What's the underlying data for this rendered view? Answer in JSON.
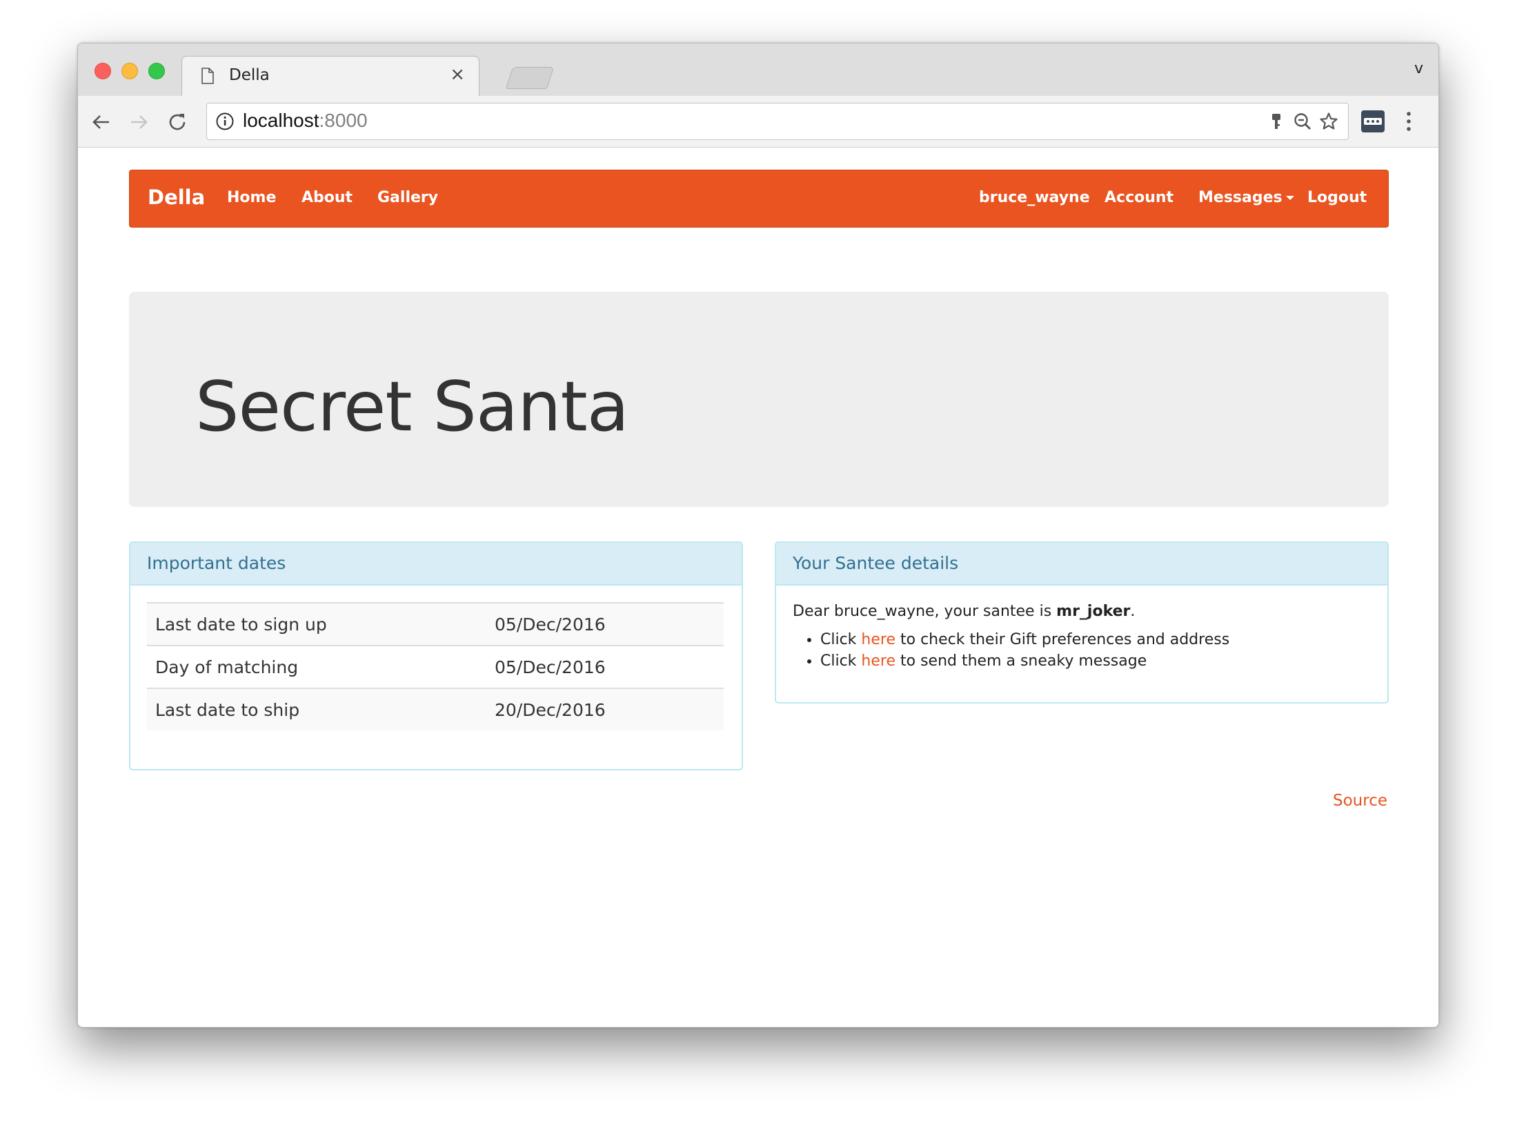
{
  "browser": {
    "tab_title": "Della",
    "tab_close": "×",
    "profile_initial": "v",
    "url_host": "localhost",
    "url_port": ":8000"
  },
  "navbar": {
    "brand": "Della",
    "left_links": [
      "Home",
      "About",
      "Gallery"
    ],
    "right_links": {
      "username": "bruce_wayne",
      "account": "Account",
      "messages": "Messages",
      "logout": "Logout"
    },
    "color": "#e95420"
  },
  "jumbotron": {
    "title": "Secret Santa"
  },
  "important_dates": {
    "heading": "Important dates",
    "rows": [
      {
        "label": "Last date to sign up",
        "date": "05/Dec/2016"
      },
      {
        "label": "Day of matching",
        "date": "05/Dec/2016"
      },
      {
        "label": "Last date to ship",
        "date": "20/Dec/2016"
      }
    ]
  },
  "santee": {
    "heading": "Your Santee details",
    "greeting_prefix": "Dear bruce_wayne, your santee is ",
    "santee_name": "mr_joker",
    "greeting_suffix": ".",
    "items": [
      {
        "prefix": "Click ",
        "link": "here",
        "suffix": " to check their Gift preferences and address"
      },
      {
        "prefix": "Click ",
        "link": "here",
        "suffix": " to send them a sneaky message"
      }
    ]
  },
  "footer": {
    "source_link": "Source"
  },
  "icons": {
    "back": "back-arrow-icon",
    "forward": "forward-arrow-icon",
    "reload": "reload-icon",
    "info": "info-icon",
    "password": "key-icon",
    "zoom": "zoom-out-icon",
    "bookmark": "star-icon",
    "extension": "extension-icon",
    "menu": "kebab-menu-icon"
  }
}
